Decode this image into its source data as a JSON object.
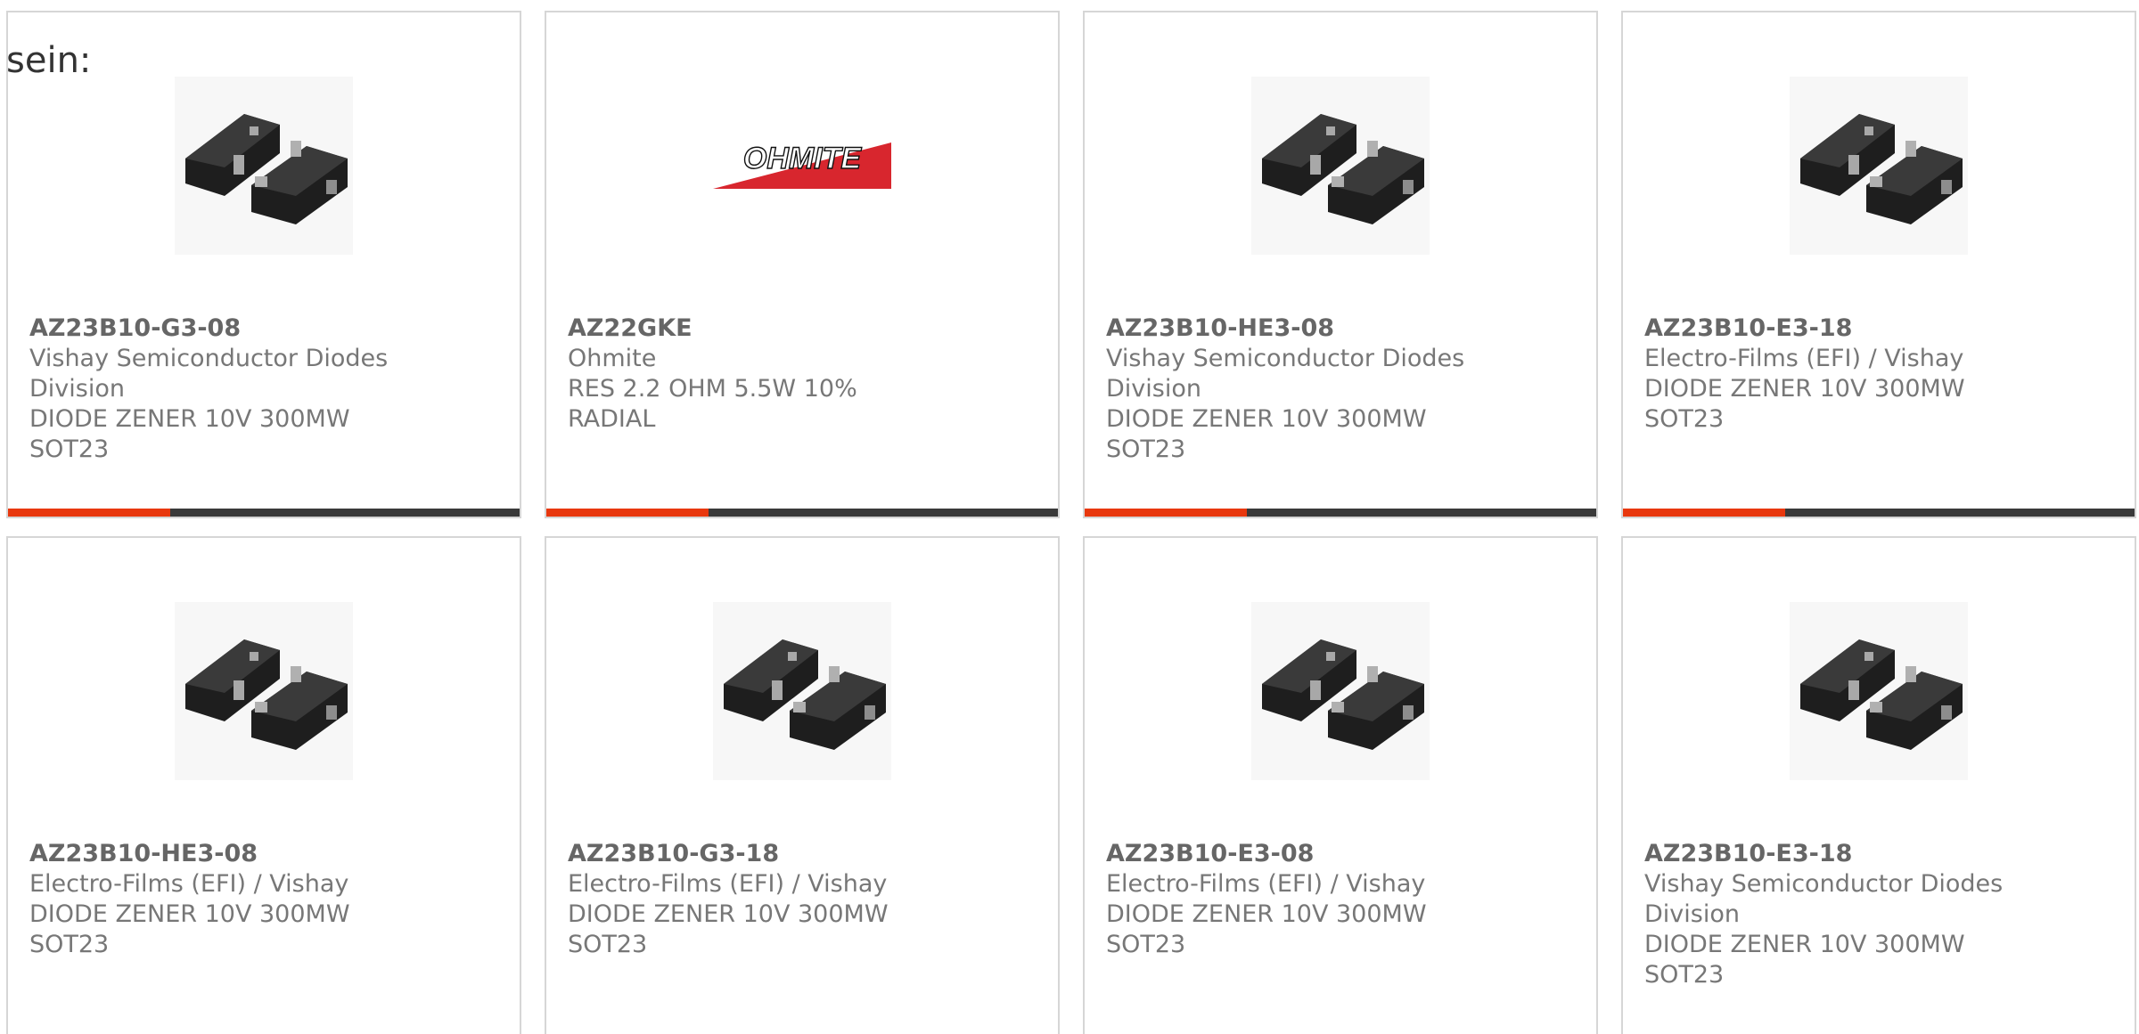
{
  "intro_text": "sein:",
  "colors": {
    "accent": "#e8380e",
    "bar_dark": "#3a3a3a",
    "border": "#d6d6d6",
    "text": "#777777",
    "logo_red": "#d8262e"
  },
  "products": [
    {
      "part_number": "AZ23B10-G3-08",
      "manufacturer": "Vishay Semiconductor Diodes Division",
      "description": "DIODE ZENER 10V 300MW SOT23",
      "image": "sot23-diode-image"
    },
    {
      "part_number": "AZ22GKE",
      "manufacturer": "Ohmite",
      "description": "RES 2.2 OHM 5.5W 10% RADIAL",
      "image": "ohmite-logo",
      "logo_text": "OHMITE"
    },
    {
      "part_number": "AZ23B10-HE3-08",
      "manufacturer": "Vishay Semiconductor Diodes Division",
      "description": "DIODE ZENER 10V 300MW SOT23",
      "image": "sot23-diode-image"
    },
    {
      "part_number": "AZ23B10-E3-18",
      "manufacturer": "Electro-Films (EFI) / Vishay",
      "description": "DIODE ZENER 10V 300MW SOT23",
      "image": "sot23-diode-image"
    },
    {
      "part_number": "AZ23B10-HE3-08",
      "manufacturer": "Electro-Films (EFI) / Vishay",
      "description": "DIODE ZENER 10V 300MW SOT23",
      "image": "sot23-diode-image"
    },
    {
      "part_number": "AZ23B10-G3-18",
      "manufacturer": "Electro-Films (EFI) / Vishay",
      "description": "DIODE ZENER 10V 300MW SOT23",
      "image": "sot23-diode-image"
    },
    {
      "part_number": "AZ23B10-E3-08",
      "manufacturer": "Electro-Films (EFI) / Vishay",
      "description": "DIODE ZENER 10V 300MW SOT23",
      "image": "sot23-diode-image"
    },
    {
      "part_number": "AZ23B10-E3-18",
      "manufacturer": "Vishay Semiconductor Diodes Division",
      "description": "DIODE ZENER 10V 300MW SOT23",
      "image": "sot23-diode-image"
    }
  ]
}
